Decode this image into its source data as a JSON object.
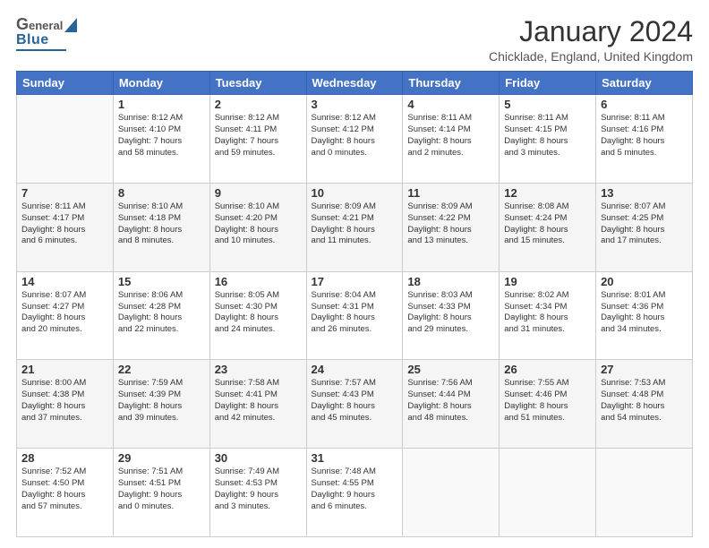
{
  "header": {
    "logo_general": "General",
    "logo_blue": "Blue",
    "title": "January 2024",
    "subtitle": "Chicklade, England, United Kingdom"
  },
  "weekdays": [
    "Sunday",
    "Monday",
    "Tuesday",
    "Wednesday",
    "Thursday",
    "Friday",
    "Saturday"
  ],
  "weeks": [
    [
      {
        "day": "",
        "info": ""
      },
      {
        "day": "1",
        "info": "Sunrise: 8:12 AM\nSunset: 4:10 PM\nDaylight: 7 hours\nand 58 minutes."
      },
      {
        "day": "2",
        "info": "Sunrise: 8:12 AM\nSunset: 4:11 PM\nDaylight: 7 hours\nand 59 minutes."
      },
      {
        "day": "3",
        "info": "Sunrise: 8:12 AM\nSunset: 4:12 PM\nDaylight: 8 hours\nand 0 minutes."
      },
      {
        "day": "4",
        "info": "Sunrise: 8:11 AM\nSunset: 4:14 PM\nDaylight: 8 hours\nand 2 minutes."
      },
      {
        "day": "5",
        "info": "Sunrise: 8:11 AM\nSunset: 4:15 PM\nDaylight: 8 hours\nand 3 minutes."
      },
      {
        "day": "6",
        "info": "Sunrise: 8:11 AM\nSunset: 4:16 PM\nDaylight: 8 hours\nand 5 minutes."
      }
    ],
    [
      {
        "day": "7",
        "info": "Sunrise: 8:11 AM\nSunset: 4:17 PM\nDaylight: 8 hours\nand 6 minutes."
      },
      {
        "day": "8",
        "info": "Sunrise: 8:10 AM\nSunset: 4:18 PM\nDaylight: 8 hours\nand 8 minutes."
      },
      {
        "day": "9",
        "info": "Sunrise: 8:10 AM\nSunset: 4:20 PM\nDaylight: 8 hours\nand 10 minutes."
      },
      {
        "day": "10",
        "info": "Sunrise: 8:09 AM\nSunset: 4:21 PM\nDaylight: 8 hours\nand 11 minutes."
      },
      {
        "day": "11",
        "info": "Sunrise: 8:09 AM\nSunset: 4:22 PM\nDaylight: 8 hours\nand 13 minutes."
      },
      {
        "day": "12",
        "info": "Sunrise: 8:08 AM\nSunset: 4:24 PM\nDaylight: 8 hours\nand 15 minutes."
      },
      {
        "day": "13",
        "info": "Sunrise: 8:07 AM\nSunset: 4:25 PM\nDaylight: 8 hours\nand 17 minutes."
      }
    ],
    [
      {
        "day": "14",
        "info": "Sunrise: 8:07 AM\nSunset: 4:27 PM\nDaylight: 8 hours\nand 20 minutes."
      },
      {
        "day": "15",
        "info": "Sunrise: 8:06 AM\nSunset: 4:28 PM\nDaylight: 8 hours\nand 22 minutes."
      },
      {
        "day": "16",
        "info": "Sunrise: 8:05 AM\nSunset: 4:30 PM\nDaylight: 8 hours\nand 24 minutes."
      },
      {
        "day": "17",
        "info": "Sunrise: 8:04 AM\nSunset: 4:31 PM\nDaylight: 8 hours\nand 26 minutes."
      },
      {
        "day": "18",
        "info": "Sunrise: 8:03 AM\nSunset: 4:33 PM\nDaylight: 8 hours\nand 29 minutes."
      },
      {
        "day": "19",
        "info": "Sunrise: 8:02 AM\nSunset: 4:34 PM\nDaylight: 8 hours\nand 31 minutes."
      },
      {
        "day": "20",
        "info": "Sunrise: 8:01 AM\nSunset: 4:36 PM\nDaylight: 8 hours\nand 34 minutes."
      }
    ],
    [
      {
        "day": "21",
        "info": "Sunrise: 8:00 AM\nSunset: 4:38 PM\nDaylight: 8 hours\nand 37 minutes."
      },
      {
        "day": "22",
        "info": "Sunrise: 7:59 AM\nSunset: 4:39 PM\nDaylight: 8 hours\nand 39 minutes."
      },
      {
        "day": "23",
        "info": "Sunrise: 7:58 AM\nSunset: 4:41 PM\nDaylight: 8 hours\nand 42 minutes."
      },
      {
        "day": "24",
        "info": "Sunrise: 7:57 AM\nSunset: 4:43 PM\nDaylight: 8 hours\nand 45 minutes."
      },
      {
        "day": "25",
        "info": "Sunrise: 7:56 AM\nSunset: 4:44 PM\nDaylight: 8 hours\nand 48 minutes."
      },
      {
        "day": "26",
        "info": "Sunrise: 7:55 AM\nSunset: 4:46 PM\nDaylight: 8 hours\nand 51 minutes."
      },
      {
        "day": "27",
        "info": "Sunrise: 7:53 AM\nSunset: 4:48 PM\nDaylight: 8 hours\nand 54 minutes."
      }
    ],
    [
      {
        "day": "28",
        "info": "Sunrise: 7:52 AM\nSunset: 4:50 PM\nDaylight: 8 hours\nand 57 minutes."
      },
      {
        "day": "29",
        "info": "Sunrise: 7:51 AM\nSunset: 4:51 PM\nDaylight: 9 hours\nand 0 minutes."
      },
      {
        "day": "30",
        "info": "Sunrise: 7:49 AM\nSunset: 4:53 PM\nDaylight: 9 hours\nand 3 minutes."
      },
      {
        "day": "31",
        "info": "Sunrise: 7:48 AM\nSunset: 4:55 PM\nDaylight: 9 hours\nand 6 minutes."
      },
      {
        "day": "",
        "info": ""
      },
      {
        "day": "",
        "info": ""
      },
      {
        "day": "",
        "info": ""
      }
    ]
  ]
}
